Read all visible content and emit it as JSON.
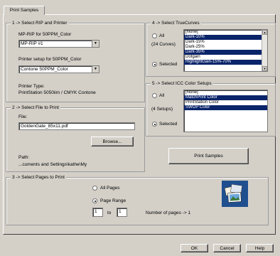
{
  "tab": {
    "label": "Print Samples"
  },
  "rip": {
    "legend": "1 -> Select RIP and Printer",
    "rip_label": "MP-RIP for 50PPM_Color",
    "rip_value": "MP-RIP #1",
    "printer_label": "Printer setup for 50PPM_Color",
    "printer_value": "Contone 50PPM_Color",
    "type_label": "Printer Type:",
    "type_value": "PrintStation 5050iim / CMYK Contone"
  },
  "file": {
    "legend": "2 -> Select File to Print",
    "file_label": "File:",
    "file_value": "GoldenGate_85x11.pdf",
    "browse_label": "Browse...",
    "path_label": "Path:",
    "path_value": "...cuments and Settings\\kathe\\My"
  },
  "pages": {
    "legend": "3 -> Select Pages to Print",
    "all_label": "All Pages",
    "range_label": "Page Range",
    "from_value": "1",
    "to_label": "to",
    "to_value": "1",
    "count_text": "Number of pages -> 1"
  },
  "curves": {
    "legend": "4 -> Select TrueCurves",
    "all_label": "All",
    "count_text": "(24 Curves)",
    "selected_label": "Selected",
    "items": [
      {
        "label": "[None]",
        "selected": false
      },
      {
        "label": "Dark-10%",
        "selected": true
      },
      {
        "label": "Dark-15%",
        "selected": false
      },
      {
        "label": "Dark-25%",
        "selected": false
      },
      {
        "label": "Dark-35%",
        "selected": true
      },
      {
        "label": "Dotgain",
        "selected": false
      },
      {
        "label": "HighlightGain-15%-70%",
        "selected": true
      }
    ]
  },
  "icc": {
    "legend": "5 -> Select ICC Color Setups",
    "all_label": "All",
    "count_text": "(4 Setups)",
    "selected_label": "Selected",
    "items": [
      {
        "label": "[None]",
        "selected": false
      },
      {
        "label": "MatchPrint Color",
        "selected": true
      },
      {
        "label": "PrintStation Color",
        "selected": false
      },
      {
        "label": "SWOP Color",
        "selected": true
      }
    ]
  },
  "print_button": "Print  Samples",
  "footer": {
    "ok": "OK",
    "cancel": "Cancel",
    "help": "Help"
  },
  "icons": {
    "photos": "photo-stack-icon"
  }
}
